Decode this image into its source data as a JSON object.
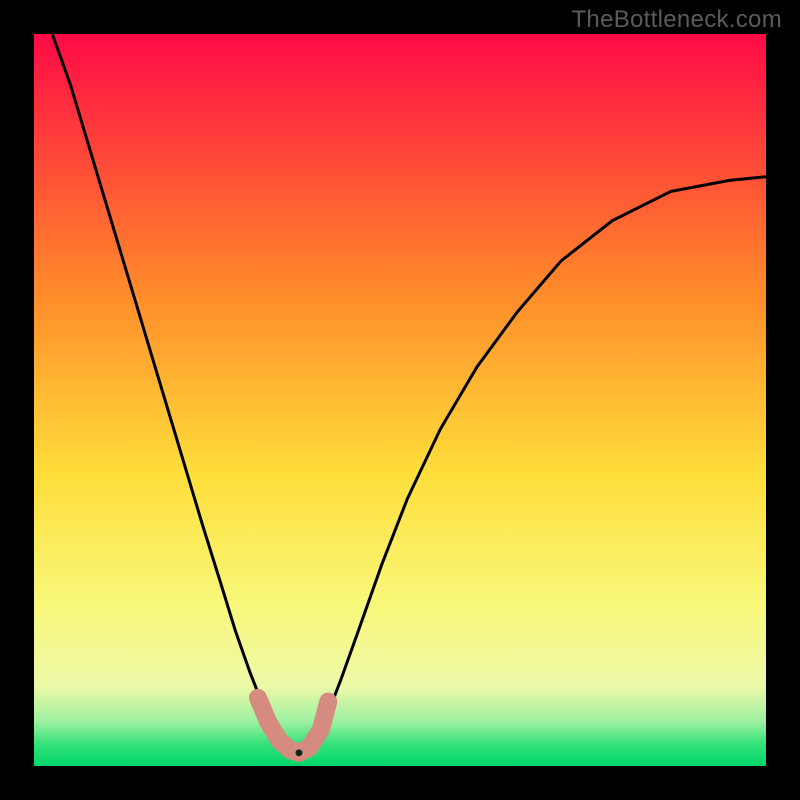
{
  "watermark": "TheBottleneck.com",
  "chart_data": {
    "type": "line",
    "title": "",
    "xlabel": "",
    "ylabel": "",
    "xlim": [
      0,
      1
    ],
    "ylim": [
      0,
      1
    ],
    "background": {
      "type": "vertical-gradient",
      "stops": [
        {
          "y": 1.0,
          "color": "#ff0a46"
        },
        {
          "y": 0.65,
          "color": "#ff8a2a"
        },
        {
          "y": 0.4,
          "color": "#ffde3a"
        },
        {
          "y": 0.22,
          "color": "#f8f87a"
        },
        {
          "y": 0.11,
          "color": "#eef9a8"
        },
        {
          "y": 0.06,
          "color": "#9cf0a0"
        },
        {
          "y": 0.03,
          "color": "#35e27a"
        },
        {
          "y": 0.0,
          "color": "#00d668"
        }
      ]
    },
    "series": [
      {
        "name": "bottleneck-curve",
        "color": "#000000",
        "width": 3,
        "x": [
          0.025,
          0.05,
          0.08,
          0.11,
          0.14,
          0.17,
          0.2,
          0.23,
          0.255,
          0.275,
          0.295,
          0.31,
          0.325,
          0.338,
          0.35,
          0.36,
          0.372,
          0.385,
          0.4,
          0.42,
          0.445,
          0.475,
          0.51,
          0.555,
          0.605,
          0.66,
          0.72,
          0.79,
          0.87,
          0.95,
          1.0
        ],
        "y": [
          1.0,
          0.93,
          0.83,
          0.73,
          0.63,
          0.53,
          0.43,
          0.33,
          0.25,
          0.185,
          0.128,
          0.09,
          0.06,
          0.038,
          0.022,
          0.015,
          0.02,
          0.035,
          0.068,
          0.12,
          0.19,
          0.275,
          0.365,
          0.46,
          0.545,
          0.62,
          0.69,
          0.745,
          0.785,
          0.8,
          0.805
        ]
      }
    ],
    "valley_marker": {
      "color": "#d68b80",
      "points": [
        {
          "x": 0.306,
          "y": 0.093
        },
        {
          "x": 0.32,
          "y": 0.06
        },
        {
          "x": 0.335,
          "y": 0.035
        },
        {
          "x": 0.35,
          "y": 0.022
        },
        {
          "x": 0.362,
          "y": 0.018
        },
        {
          "x": 0.376,
          "y": 0.025
        },
        {
          "x": 0.392,
          "y": 0.05
        },
        {
          "x": 0.402,
          "y": 0.088
        }
      ]
    }
  }
}
